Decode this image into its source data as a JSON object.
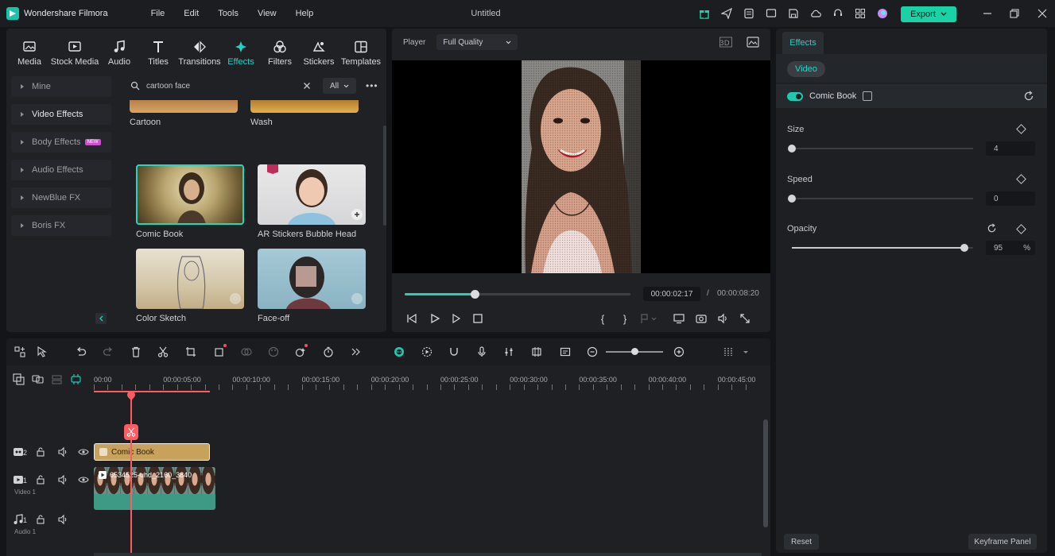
{
  "app": {
    "name": "Wondershare Filmora",
    "title": "Untitled",
    "menu": [
      "File",
      "Edit",
      "Tools",
      "View",
      "Help"
    ],
    "export_label": "Export",
    "accent": "#19d3a7"
  },
  "media": {
    "tabs": [
      "Media",
      "Stock Media",
      "Audio",
      "Titles",
      "Transitions",
      "Effects",
      "Filters",
      "Stickers",
      "Templates"
    ],
    "active_tab": "Effects",
    "sidebar": [
      "Mine",
      "Video Effects",
      "Body Effects",
      "Audio Effects",
      "NewBlue FX",
      "Boris FX"
    ],
    "new_badge": "NEW",
    "search_value": "cartoon face",
    "filter_value": "All",
    "more": "•••",
    "effects": [
      {
        "name": "Cartoon"
      },
      {
        "name": "Wash"
      },
      {
        "name": "Comic Book"
      },
      {
        "name": "AR Stickers Bubble Head"
      },
      {
        "name": "Color Sketch"
      },
      {
        "name": "Face-off"
      }
    ]
  },
  "player": {
    "label": "Player",
    "quality": "Full Quality",
    "current_time": "00:00:02:17",
    "separator": "/",
    "total_time": "00:00:08:20",
    "progress": 0.31,
    "brace_open": "{",
    "brace_close": "}"
  },
  "props": {
    "tab": "Effects",
    "sub_tab": "Video",
    "effect_name": "Comic Book",
    "effect_enabled": true,
    "params": [
      {
        "label": "Size",
        "value": "4",
        "level": 0.0
      },
      {
        "label": "Speed",
        "value": "0",
        "level": 0.0
      },
      {
        "label": "Opacity",
        "value": "95",
        "unit": "%",
        "level": 0.95
      }
    ],
    "reset_label": "Reset",
    "keyframe_label": "Keyframe Panel"
  },
  "timeline": {
    "ruler": [
      "00:00",
      "00:00:05:00",
      "00:00:10:00",
      "00:00:15:00",
      "00:00:20:00",
      "00:00:25:00",
      "00:00:30:00",
      "00:00:35:00",
      "00:00:40:00",
      "00:00:45:00"
    ],
    "tracks": [
      {
        "num": "2",
        "label": ""
      },
      {
        "num": "1",
        "label": "Video 1"
      },
      {
        "num": "1",
        "label": "Audio 1"
      }
    ],
    "fx_clip": "Comic Book",
    "video_clip": "6534525-uhd_2160_3840"
  }
}
